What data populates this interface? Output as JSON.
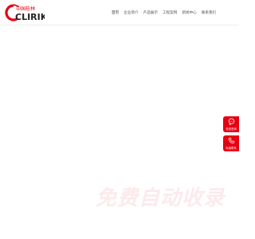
{
  "logo": {
    "brand_cn": "中国桂林",
    "brand_en": "CLIRIK",
    "colors": {
      "primary": "#e60012",
      "text": "#222222"
    }
  },
  "nav": {
    "items": [
      {
        "label": "首页",
        "active": true
      },
      {
        "label": "企业简介"
      },
      {
        "label": "产品展示"
      },
      {
        "label": "工程案例"
      },
      {
        "label": "新闻中心"
      },
      {
        "label": "联系我们"
      }
    ]
  },
  "side_widgets": [
    {
      "label": "在线咨询",
      "icon": "chat-bubble-icon"
    },
    {
      "label": "电话联系",
      "icon": "phone-icon"
    }
  ],
  "watermark": {
    "text": "免费自动收录"
  },
  "colors": {
    "accent": "#e60012"
  }
}
